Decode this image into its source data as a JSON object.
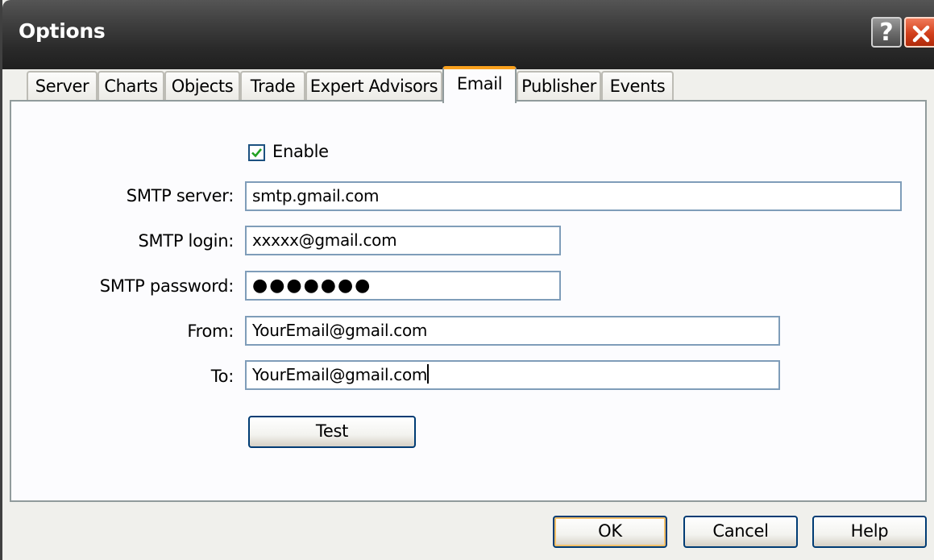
{
  "window": {
    "title": "Options",
    "help_glyph": "?",
    "close_icon": "close-icon"
  },
  "tabs": [
    {
      "label": "Server"
    },
    {
      "label": "Charts"
    },
    {
      "label": "Objects"
    },
    {
      "label": "Trade"
    },
    {
      "label": "Expert Advisors"
    },
    {
      "label": "Email",
      "active": true
    },
    {
      "label": "Publisher"
    },
    {
      "label": "Events"
    }
  ],
  "email": {
    "enable_label": "Enable",
    "enable_checked": true,
    "smtp_server_label": "SMTP server:",
    "smtp_server_value": "smtp.gmail.com",
    "smtp_login_label": "SMTP login:",
    "smtp_login_value": "xxxxx@gmail.com",
    "smtp_password_label": "SMTP password:",
    "smtp_password_value": "●●●●●●●",
    "from_label": "From:",
    "from_value": "YourEmail@gmail.com",
    "to_label": "To:",
    "to_value": "YourEmail@gmail.com",
    "test_button": "Test"
  },
  "footer": {
    "ok": "OK",
    "cancel": "Cancel",
    "help": "Help"
  },
  "colors": {
    "active_tab_accent": "#f9a11d",
    "close_button": "#d2401c",
    "button_border": "#003c74"
  }
}
